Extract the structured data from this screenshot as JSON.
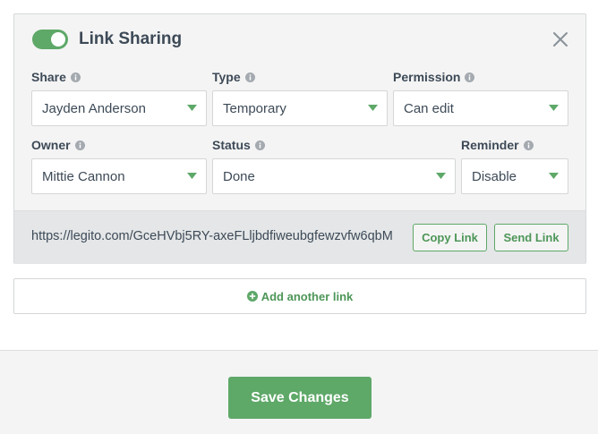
{
  "colors": {
    "accent": "#5ea868",
    "accent_text": "#4d9658",
    "text": "#3d4a57",
    "panel_bg": "#f4f4f4",
    "link_bar_bg": "#e4e6e7",
    "border": "#d4d6d8"
  },
  "icons": {
    "close": "close-icon",
    "info": "info-icon",
    "caret": "caret-down-icon",
    "plus": "plus-circle-icon"
  },
  "panel": {
    "toggle_on": true,
    "title": "Link Sharing"
  },
  "fields": {
    "share": {
      "label": "Share",
      "value": "Jayden Anderson"
    },
    "type": {
      "label": "Type",
      "value": "Temporary"
    },
    "permission": {
      "label": "Permission",
      "value": "Can edit"
    },
    "owner": {
      "label": "Owner",
      "value": "Mittie Cannon"
    },
    "status": {
      "label": "Status",
      "value": "Done"
    },
    "reminder": {
      "label": "Reminder",
      "value": "Disable"
    }
  },
  "link": {
    "url": "https://legito.com/GceHVbj5RY-axeFLljbdfiweubgfewzvfw6qbM",
    "copy_label": "Copy Link",
    "send_label": "Send Link"
  },
  "add_link_label": "Add another link",
  "footer": {
    "save_label": "Save Changes"
  }
}
